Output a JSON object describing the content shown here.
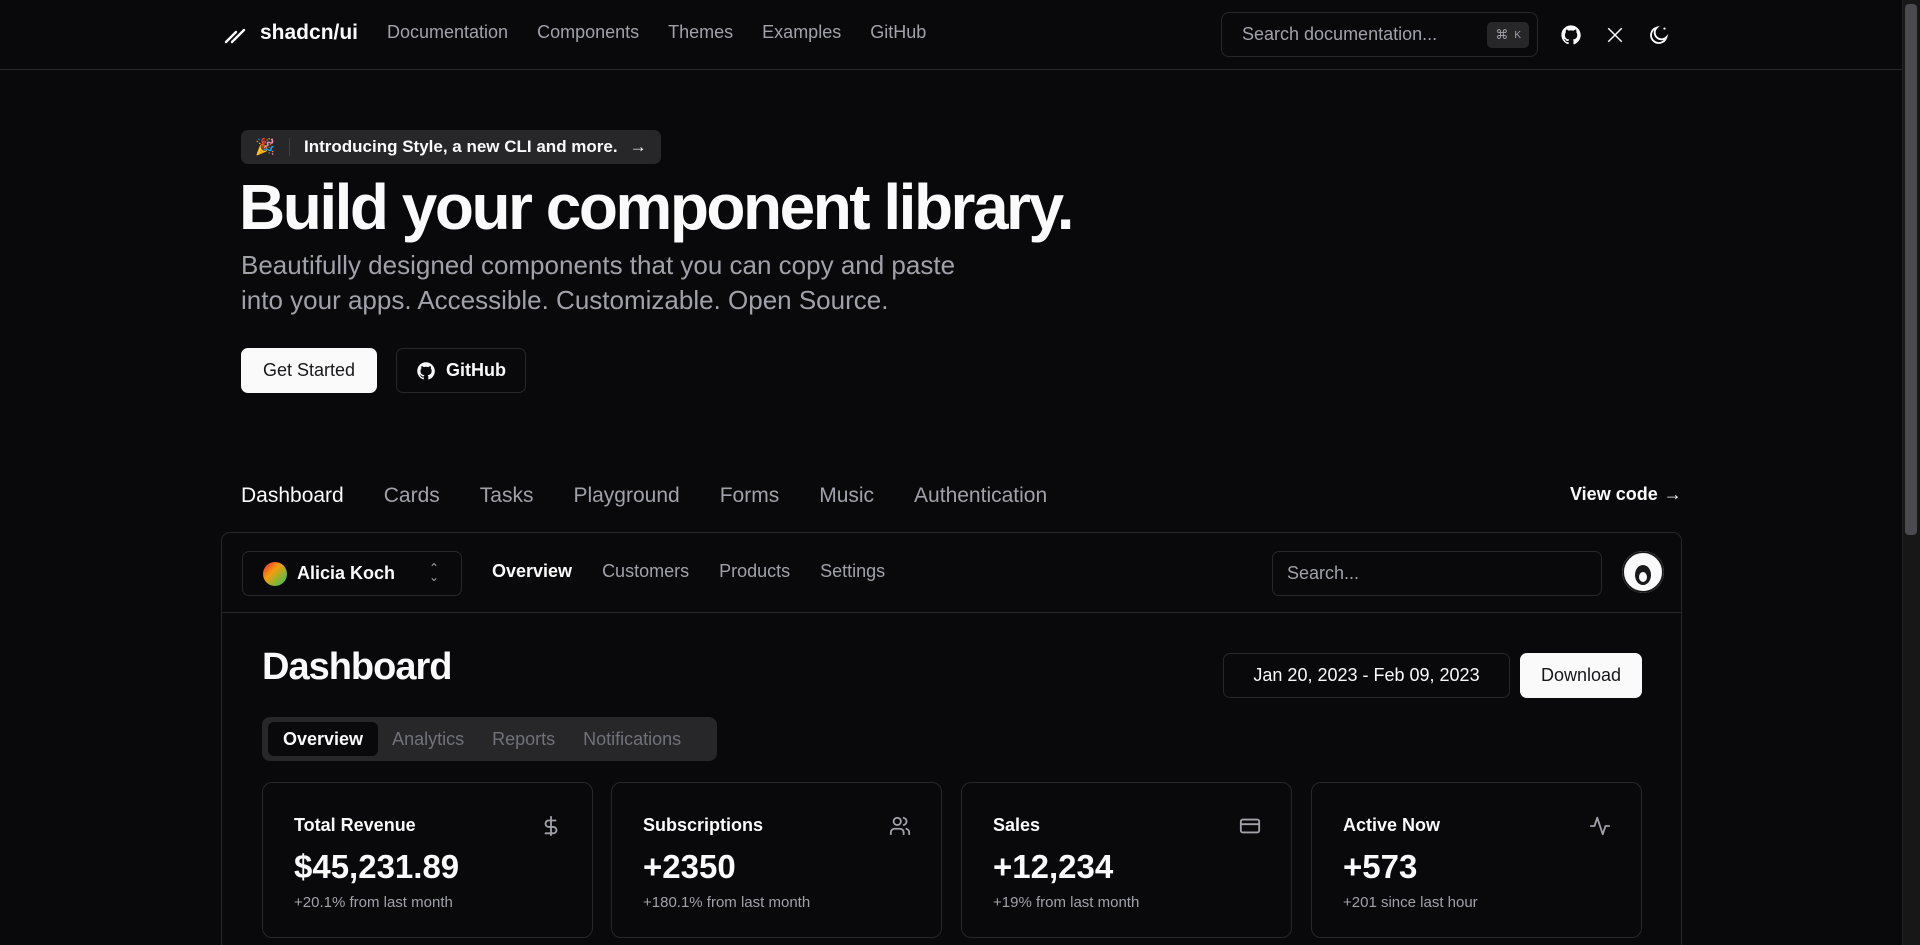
{
  "header": {
    "logo_text": "shadcn/ui",
    "nav": [
      "Documentation",
      "Components",
      "Themes",
      "Examples",
      "GitHub"
    ],
    "search_placeholder": "Search documentation...",
    "shortcut_symbol": "⌘",
    "shortcut_key": "K",
    "icons": [
      "github-icon",
      "x-icon",
      "theme-toggle-icon"
    ]
  },
  "hero": {
    "announcement_emoji": "🎉",
    "announcement": "Introducing Style, a new CLI and more.",
    "title": "Build your component library.",
    "description": "Beautifully designed components that you can copy and paste into your apps. Accessible. Customizable. Open Source.",
    "primary_button": "Get Started",
    "secondary_button": "GitHub"
  },
  "examples": {
    "tabs": [
      "Dashboard",
      "Cards",
      "Tasks",
      "Playground",
      "Forms",
      "Music",
      "Authentication"
    ],
    "active_tab": "Dashboard",
    "view_code": "View code"
  },
  "preview": {
    "team": "Alicia Koch",
    "nav": [
      "Overview",
      "Customers",
      "Products",
      "Settings"
    ],
    "search_placeholder": "Search...",
    "title": "Dashboard",
    "date_range": "Jan 20, 2023 - Feb 09, 2023",
    "download": "Download",
    "tabs": [
      "Overview",
      "Analytics",
      "Reports",
      "Notifications"
    ],
    "cards": [
      {
        "title": "Total Revenue",
        "value": "$45,231.89",
        "sub": "+20.1% from last month",
        "icon": "dollar-icon"
      },
      {
        "title": "Subscriptions",
        "value": "+2350",
        "sub": "+180.1% from last month",
        "icon": "users-icon"
      },
      {
        "title": "Sales",
        "value": "+12,234",
        "sub": "+19% from last month",
        "icon": "credit-card-icon"
      },
      {
        "title": "Active Now",
        "value": "+573",
        "sub": "+201 since last hour",
        "icon": "activity-icon"
      }
    ]
  },
  "colors": {
    "background": "#09090b",
    "border": "#27272a",
    "foreground": "#fafafa",
    "muted": "#a1a1aa"
  }
}
